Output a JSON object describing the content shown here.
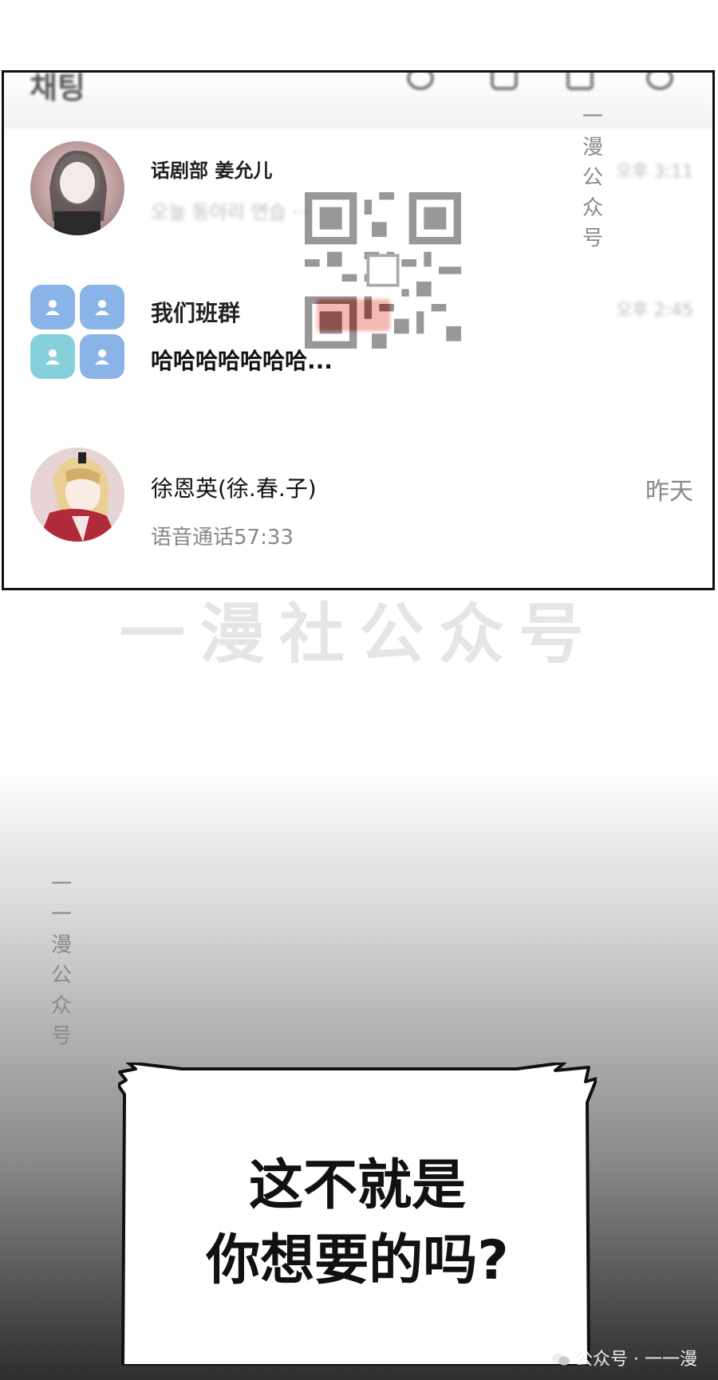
{
  "chat_list": [
    {
      "name": "话剧部 姜允儿",
      "preview": "",
      "time": ""
    },
    {
      "name": "我们班群",
      "preview": "哈哈哈哈哈哈哈...",
      "time": ""
    },
    {
      "name": "徐恩英(徐.春.子)",
      "preview": "语音通话57:33",
      "time": "昨天"
    }
  ],
  "watermarks": {
    "vertical_right": "一漫公众号",
    "vertical_left": "一一漫公众号",
    "horizontal": "一漫社公众号",
    "footer": "公众号 · 一一漫"
  },
  "speech_bubble": {
    "line1": "这不就是",
    "line2": "你想要的吗?"
  },
  "colors": {
    "group_blue": "#8ab4e8",
    "group_teal": "#86d0dc",
    "badge_red": "#e0463d",
    "panel_border": "#111111"
  },
  "icons": [
    "search-icon",
    "chat-icon",
    "contacts-icon",
    "settings-icon",
    "wechat-icon"
  ]
}
